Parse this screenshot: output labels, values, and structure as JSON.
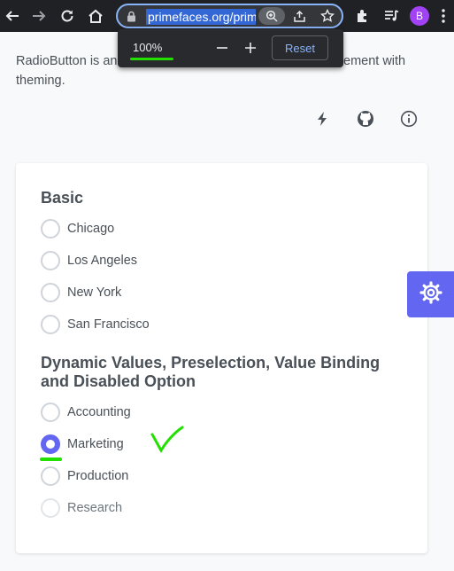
{
  "browser": {
    "url": "primefaces.org/prim",
    "profile_initial": "B",
    "icons": [
      "back-arrow-icon",
      "forward-arrow-icon",
      "reload-icon",
      "home-icon",
      "lock-icon",
      "zoom-icon",
      "share-icon",
      "star-icon",
      "extensions-icon",
      "media-icon"
    ]
  },
  "zoom_popup": {
    "level": "100%",
    "reset_label": "Reset"
  },
  "page": {
    "intro_line1": "RadioButton is an",
    "intro_line1_end": "ement with",
    "intro_line2": "theming."
  },
  "card": {
    "basic_title": "Basic",
    "basic_options": [
      "Chicago",
      "Los Angeles",
      "New York",
      "San Francisco"
    ],
    "dynamic_title": "Dynamic Values, Preselection, Value Binding and Disabled Option",
    "dynamic_options": [
      "Accounting",
      "Marketing",
      "Production",
      "Research"
    ],
    "selected": "Marketing",
    "disabled": "Research"
  },
  "colors": {
    "accent": "#6366f1",
    "annotation": "#22e000",
    "omnibox_focus": "#8ab4f8"
  }
}
